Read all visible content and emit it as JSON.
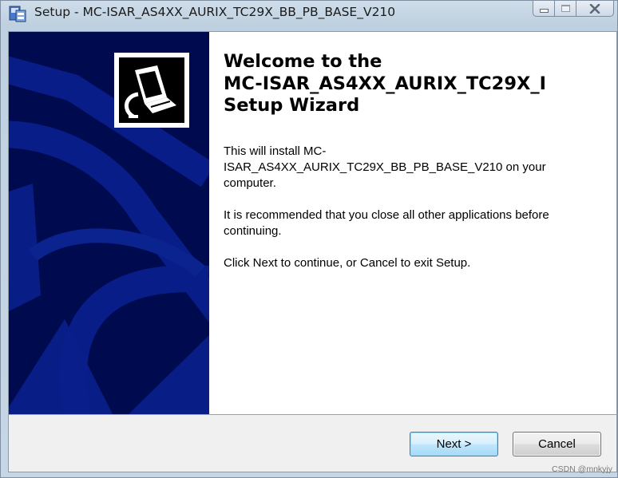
{
  "window": {
    "title": "Setup - MC-ISAR_AS4XX_AURIX_TC29X_BB_PB_BASE_V210",
    "icon": "setup-installer-icon",
    "controls": [
      "minimize-icon",
      "maximize-icon",
      "close-icon"
    ]
  },
  "banner": {
    "logo_icon": "computer-install-icon",
    "colors": {
      "background": "#000b4f",
      "shapes": "#0a1f8c"
    }
  },
  "wizard": {
    "heading_line1": "Welcome to the",
    "heading_line2": "MC-ISAR_AS4XX_AURIX_TC29X_I",
    "heading_line3": "Setup Wizard",
    "para1": "This will install MC-ISAR_AS4XX_AURIX_TC29X_BB_PB_BASE_V210 on your computer.",
    "para2": "It is recommended that you close all other applications before continuing.",
    "para3": "Click Next to continue, or Cancel to exit Setup."
  },
  "buttons": {
    "next_label": "Next >",
    "cancel_label": "Cancel"
  },
  "watermark": "CSDN @mnkyjy"
}
